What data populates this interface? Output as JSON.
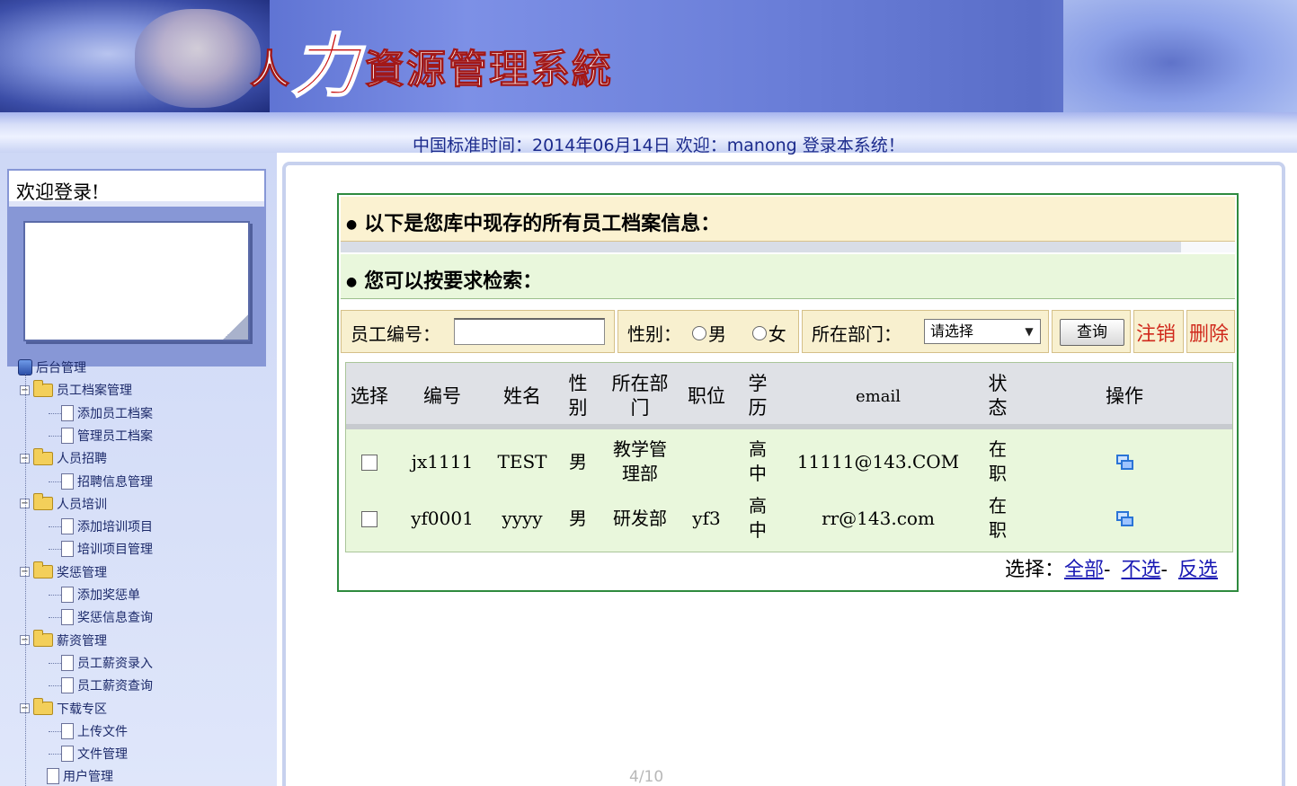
{
  "banner": {
    "title_part1": "人",
    "title_part2": "力",
    "title_part3": "資源管理系統"
  },
  "statusbar": {
    "text": "中国标准时间：2014年06月14日  欢迎：manong 登录本系统！"
  },
  "sidebar": {
    "welcome_title": "欢迎登录!",
    "tree": [
      {
        "level": 0,
        "type": "root",
        "label": "后台管理"
      },
      {
        "level": 1,
        "type": "folder",
        "label": "员工档案管理"
      },
      {
        "level": 2,
        "type": "page",
        "label": "添加员工档案"
      },
      {
        "level": 2,
        "type": "page",
        "label": "管理员工档案"
      },
      {
        "level": 1,
        "type": "folder",
        "label": "人员招聘"
      },
      {
        "level": 2,
        "type": "page",
        "label": "招聘信息管理"
      },
      {
        "level": 1,
        "type": "folder",
        "label": "人员培训"
      },
      {
        "level": 2,
        "type": "page",
        "label": "添加培训项目"
      },
      {
        "level": 2,
        "type": "page",
        "label": "培训项目管理"
      },
      {
        "level": 1,
        "type": "folder",
        "label": "奖惩管理"
      },
      {
        "level": 2,
        "type": "page",
        "label": "添加奖惩单"
      },
      {
        "level": 2,
        "type": "page",
        "label": "奖惩信息查询"
      },
      {
        "level": 1,
        "type": "folder",
        "label": "薪资管理"
      },
      {
        "level": 2,
        "type": "page",
        "label": "员工薪资录入"
      },
      {
        "level": 2,
        "type": "page",
        "label": "员工薪资查询"
      },
      {
        "level": 1,
        "type": "folder",
        "label": "下载专区"
      },
      {
        "level": 2,
        "type": "page",
        "label": "上传文件"
      },
      {
        "level": 2,
        "type": "page",
        "label": "文件管理"
      },
      {
        "level": 1,
        "type": "page",
        "label": "用户管理"
      }
    ]
  },
  "main": {
    "heading1": "以下是您库中现存的所有员工档案信息：",
    "heading2": "您可以按要求检索：",
    "search": {
      "empid_label": "员工编号：",
      "empid_value": "",
      "gender_label": "性别：",
      "gender_male": "男",
      "gender_female": "女",
      "dept_label": "所在部门：",
      "dept_selected": "请选择",
      "query_label": "查询",
      "logout_label": "注销",
      "delete_label": "删除"
    },
    "table": {
      "headers": [
        "选择",
        "编号",
        "姓名",
        "性别",
        "所在部门",
        "职位",
        "学历",
        "email",
        "状态",
        "操作"
      ],
      "header_lines": {
        "gender": [
          "性",
          "别"
        ],
        "dept": [
          "所在部",
          "门"
        ],
        "edu": [
          "学",
          "历"
        ],
        "status": [
          "状",
          "态"
        ]
      },
      "rows": [
        {
          "id": "jx1111",
          "name": "TEST",
          "gender": "男",
          "dept": [
            "教学管",
            "理部"
          ],
          "position": "",
          "edu": [
            "高",
            "中"
          ],
          "email": "11111@143.COM",
          "status": [
            "在",
            "职"
          ]
        },
        {
          "id": "yf0001",
          "name": "yyyy",
          "gender": "男",
          "dept": [
            "研发部"
          ],
          "position": "yf3",
          "edu": [
            "高",
            "中"
          ],
          "email": "rr@143.com",
          "status": [
            "在",
            "职"
          ]
        }
      ]
    },
    "select_row": {
      "label": "选择：",
      "all": "全部",
      "none": "不选",
      "invert": "反选",
      "dash": "-"
    }
  },
  "pager": {
    "text": "4/10"
  },
  "colors": {
    "banner": "#5a6fd0",
    "green_border": "#2e8a3e",
    "red_link": "#d0291c",
    "link": "#1a1ab4"
  }
}
